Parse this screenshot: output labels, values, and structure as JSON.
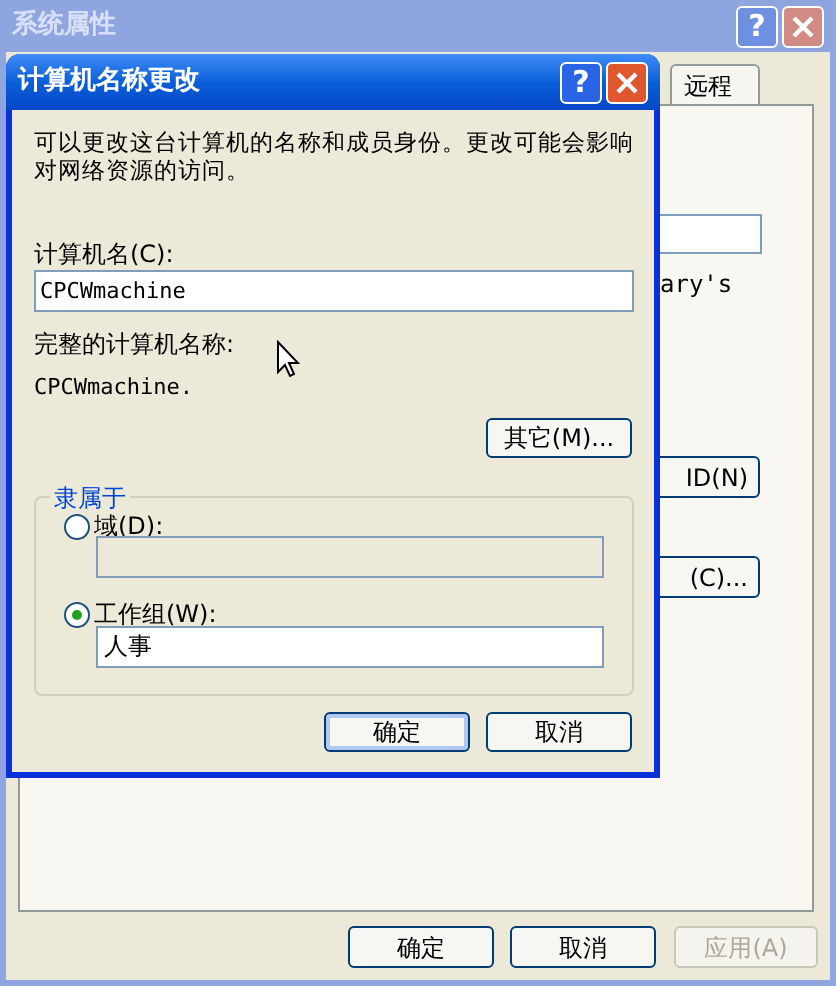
{
  "back_window": {
    "title": "系统属性",
    "help_glyph": "?",
    "tabs": [
      {
        "label": "远程",
        "selected": false
      }
    ],
    "text_fragment": "ary's",
    "buttons": [
      {
        "label": "ID(N)",
        "disabled": false
      },
      {
        "label": "(C)...",
        "disabled": false
      }
    ],
    "footer_buttons": [
      {
        "label": "确定",
        "disabled": false
      },
      {
        "label": "取消",
        "disabled": false
      },
      {
        "label": "应用(A)",
        "disabled": true
      }
    ]
  },
  "dialog": {
    "title": "计算机名称更改",
    "help_glyph": "?",
    "description": "可以更改这台计算机的名称和成员身份。更改可能会影响对网络资源的访问。",
    "computer_name_label": "计算机名(C):",
    "computer_name_value": "CPCWmachine",
    "full_name_label": "完整的计算机名称:",
    "full_name_value": "CPCWmachine.",
    "more_button": "其它(M)...",
    "member_of": {
      "legend": "隶属于",
      "options": [
        {
          "label": "域(D):",
          "selected": false
        },
        {
          "label": "工作组(W):",
          "selected": true,
          "value": "人事"
        }
      ]
    },
    "buttons": [
      {
        "label": "确定",
        "default": true
      },
      {
        "label": "取消",
        "default": false
      }
    ]
  }
}
